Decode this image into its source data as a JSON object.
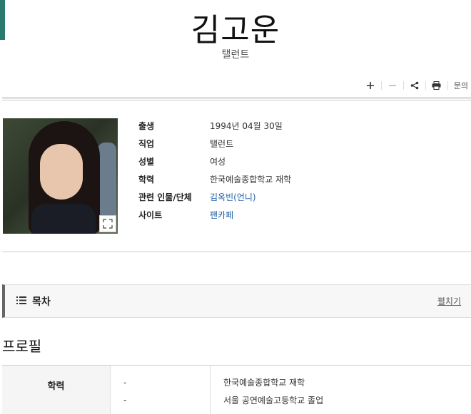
{
  "header": {
    "title": "김고운",
    "subtitle": "탤런트"
  },
  "toolbar": {
    "plus_icon": "plus-icon",
    "minus_icon": "minus-icon",
    "share_icon": "share-icon",
    "print_icon": "print-icon",
    "inquiry_label": "문의"
  },
  "info": {
    "rows": [
      {
        "label": "출생",
        "value": "1994년 04월 30일"
      },
      {
        "label": "직업",
        "value": "탤런트"
      },
      {
        "label": "성별",
        "value": "여성"
      },
      {
        "label": "학력",
        "value": "한국예술종합학교 재학"
      },
      {
        "label": "관련 인물/단체",
        "value": "김옥빈(언니)"
      },
      {
        "label": "사이트",
        "value": "팬카페"
      }
    ]
  },
  "toc": {
    "title": "목차",
    "toggle_label": "펼치기"
  },
  "profile": {
    "section_title": "프로필",
    "education": {
      "label": "학력",
      "entries": [
        {
          "year": "-",
          "detail": "한국예술종합학교 재학"
        },
        {
          "year": "-",
          "detail": "서울 공연예술고등학교 졸업"
        }
      ]
    }
  },
  "colors": {
    "accent": "#2b7a6f",
    "link": "#1e5fa6"
  }
}
